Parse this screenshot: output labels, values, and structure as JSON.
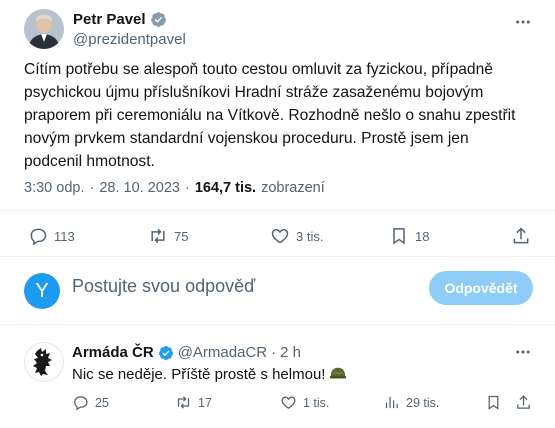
{
  "tweet": {
    "author_name": "Petr Pavel",
    "author_handle": "@prezidentpavel",
    "text": "Cítím potřebu se alespoň touto cestou omluvit za fyzickou, případně psychickou újmu příslušníkovi Hradní stráže zasaženému bojovým praporem při ceremoniálu na Vítkově. Rozhodně nešlo o snahu zpestřit novým prvkem standardní vojenskou proceduru. Prostě jsem jen podcenil hmotnost.",
    "time": "3:30 odp.",
    "separator": "·",
    "date": "28. 10. 2023",
    "views_count": "164,7 tis.",
    "views_label": "zobrazení",
    "actions": {
      "replies": "113",
      "retweets": "75",
      "likes": "3 tis.",
      "bookmarks": "18"
    }
  },
  "composer": {
    "avatar_letter": "Y",
    "placeholder": "Postujte svou odpověď",
    "reply_button": "Odpovědět"
  },
  "reply": {
    "author_name": "Armáda ČR",
    "author_handle": "@ArmadaCR",
    "separator": "·",
    "time": "2 h",
    "text": "Nic se neděje. Příště prostě s helmou!",
    "actions": {
      "replies": "25",
      "retweets": "17",
      "likes": "1 tis.",
      "views": "29 tis."
    }
  },
  "colors": {
    "verified": "#1d9bf0",
    "muted": "#536471",
    "button": "#8ecdf7"
  }
}
